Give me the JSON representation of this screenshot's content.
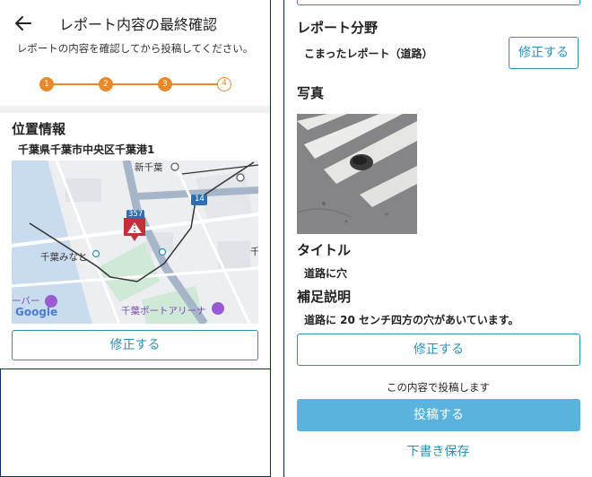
{
  "left": {
    "header": {
      "title": "レポート内容の最終確認",
      "subtitle": "レポートの内容を確認してから投稿してください。"
    },
    "stepper": {
      "steps": [
        "1",
        "2",
        "3",
        "4"
      ],
      "current": 4
    },
    "location": {
      "title": "位置情報",
      "address": "千葉県千葉市中央区千葉港1"
    },
    "map": {
      "labels": {
        "shinchiba": "新千葉",
        "chibaminato": "千葉みなと",
        "arena": "千葉ポートアリーナ",
        "road_357": "357",
        "road_14": "14",
        "edge_text": "ーバー",
        "edge_right": "千",
        "google": "Google"
      }
    },
    "edit_button": "修正する"
  },
  "right": {
    "category": {
      "title": "レポート分野",
      "value": "こまったレポート（道路）",
      "edit_button": "修正する"
    },
    "photo": {
      "title": "写真"
    },
    "title_section": {
      "title": "タイトル",
      "value": "道路に穴"
    },
    "description": {
      "title": "補足説明",
      "value": "道路に 20 センチ四方の穴があいています。"
    },
    "edit_button": "修正する",
    "confirm_text": "この内容で投稿します",
    "submit_button": "投稿する",
    "draft_button": "下書き保存"
  },
  "colors": {
    "accent": "#2b8fb8",
    "primary_button": "#59b3dc",
    "stepper": "#e8892a",
    "pin": "#c0313a"
  }
}
